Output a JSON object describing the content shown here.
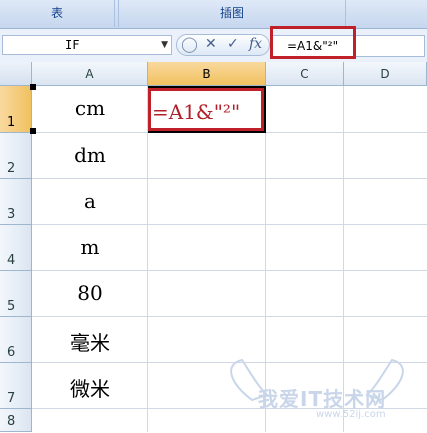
{
  "ribbon": {
    "groups": [
      "表",
      "插图"
    ]
  },
  "formula_bar": {
    "name_box": "IF",
    "formula": "=A1&\"²\"",
    "fx_label": "fx"
  },
  "sheet": {
    "columns": [
      "A",
      "B",
      "C",
      "D"
    ],
    "rows": [
      "1",
      "2",
      "3",
      "4",
      "5",
      "6",
      "7",
      "8"
    ],
    "column_a_values": [
      "cm",
      "dm",
      "a",
      "m",
      "80",
      "毫米",
      "微米"
    ],
    "editing_cell_b1": "=A1&\"²\""
  },
  "watermark": {
    "text": "我爱IT技术网",
    "url": "www.52ij.com"
  },
  "colors": {
    "highlight": "#c0202a",
    "formula_text_in_cell": "#b0202a",
    "active_header": "#f1c15f"
  }
}
